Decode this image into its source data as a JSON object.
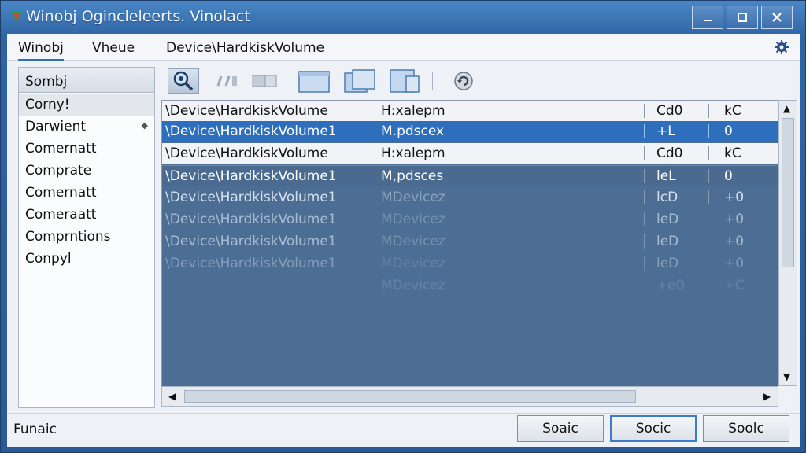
{
  "window": {
    "title": "Winobj Ogincleleerts. Vinolact"
  },
  "menubar": {
    "items": [
      "Winobj",
      "Vheue",
      "Device\\HardkiskVolume"
    ]
  },
  "sidebar": {
    "header": "Sombj",
    "items": [
      {
        "label": "Corny!"
      },
      {
        "label": "Darwient"
      },
      {
        "label": "Comernatt"
      },
      {
        "label": "Comprate"
      },
      {
        "label": "Comernatt"
      },
      {
        "label": "Comeraatt"
      },
      {
        "label": "Comprntions"
      },
      {
        "label": "Conpyl"
      }
    ]
  },
  "list": {
    "rows": [
      {
        "c1": "\\Device\\HardkiskVolume",
        "c2": "H:xalepm",
        "c3": "Cd0",
        "c4": "kC"
      },
      {
        "c1": "\\Device\\HardkiskVolume1",
        "c2": "M.pdscex",
        "c3": "+L",
        "c4": "0"
      },
      {
        "c1": "\\Device\\HardkiskVolume",
        "c2": "H:xalepm",
        "c3": "Cd0",
        "c4": "kC"
      },
      {
        "c1": "\\Device\\HardkiskVolume1",
        "c2": "M,pdsces",
        "c3": "leL",
        "c4": "0"
      },
      {
        "c1": "\\Device\\HardkiskVolume1",
        "c2": "MDevicez",
        "c3": "lcD",
        "c4": "+0"
      },
      {
        "c1": "\\Device\\HardkiskVolume1",
        "c2": "MDevicez",
        "c3": "leD",
        "c4": "+0"
      },
      {
        "c1": "\\Device\\HardkiskVolume1",
        "c2": "MDevicez",
        "c3": "leD",
        "c4": "+0"
      },
      {
        "c1": "\\Device\\HardkiskVolume1",
        "c2": "MDevicez",
        "c3": "leD",
        "c4": "+0"
      },
      {
        "c1": "",
        "c2": "MDevicez",
        "c3": "+e0",
        "c4": "+C"
      }
    ]
  },
  "status": {
    "text": "Funaic"
  },
  "buttons": {
    "b1": "Soaic",
    "b2": "Socic",
    "b3": "Soolc"
  },
  "colors": {
    "accent": "#2e6fbd",
    "selection": "#2e6fbd",
    "listBackground": "#4d6e94"
  }
}
